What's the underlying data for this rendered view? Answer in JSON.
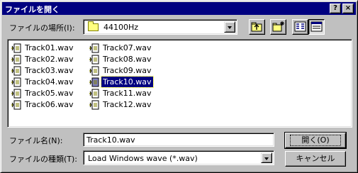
{
  "window": {
    "title": "ファイルを開く",
    "help_label": "?",
    "close_label": "×"
  },
  "location": {
    "label": "ファイルの場所(I):",
    "value": "44100Hz"
  },
  "toolbar": {
    "icons": [
      "up-one-level-icon",
      "new-folder-icon",
      "list-view-icon",
      "details-view-icon"
    ]
  },
  "files": {
    "column1": [
      "Track01.wav",
      "Track02.wav",
      "Track03.wav",
      "Track04.wav",
      "Track05.wav",
      "Track06.wav"
    ],
    "column2": [
      "Track07.wav",
      "Track08.wav",
      "Track09.wav",
      "Track10.wav",
      "Track11.wav",
      "Track12.wav"
    ],
    "selected": "Track10.wav"
  },
  "filename": {
    "label": "ファイル名(N):",
    "value": "Track10.wav"
  },
  "filetype": {
    "label": "ファイルの種類(T):",
    "value": "Load Windows wave (*.wav)"
  },
  "buttons": {
    "open": "開く(O)",
    "cancel": "キャンセル"
  },
  "colors": {
    "titlebar": "#000080",
    "face": "#c0c0c0",
    "selection": "#000080"
  }
}
